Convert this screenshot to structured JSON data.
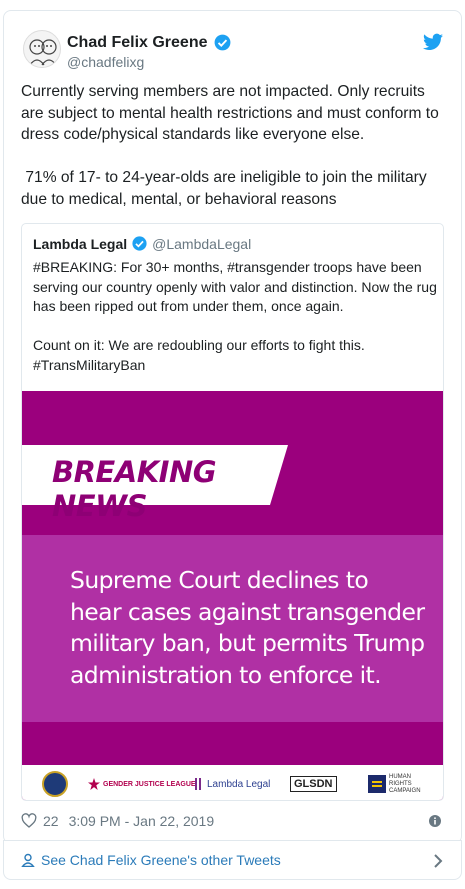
{
  "tweet": {
    "author_name": "Chad Felix Greene",
    "author_handle": "@chadfelixg",
    "text": "Currently serving members are not impacted. Only recruits are subject to mental health restrictions and must conform to dress code/physical standards like everyone else.\n\n 71% of 17- to 24-year-olds are ineligible to join the military due to medical, mental, or behavioral reasons",
    "likes": "22",
    "timestamp": "3:09 PM - Jan 22, 2019"
  },
  "quote": {
    "name": "Lambda Legal",
    "handle": "@LambdaLegal",
    "text": "#BREAKING: For 30+ months, #transgender troops have been serving our country openly with valor and distinction. Now the rug has been ripped out from under them, once again.\n\nCount on it: We are redoubling our efforts to fight this. #TransMilitaryBan",
    "media": {
      "ribbon": "BREAKING NEWS",
      "headline": "Supreme Court declines to\nhear cases against transgender\nmilitary ban, but permits Trump\nadministration to enforce it.",
      "logos": {
        "gender_justice": "GENDER JUSTICE LEAGUE",
        "lambda_legal": "Lambda Legal",
        "glad": "GLSDN",
        "hrc": "HUMAN RIGHTS CAMPAIGN"
      }
    }
  },
  "footer": {
    "other_tweets_label": "See Chad Felix Greene's other Tweets"
  },
  "icons": [
    "avatar-illustration",
    "verified-badge-icon",
    "twitter-bird-icon",
    "heart-icon",
    "info-icon",
    "person-icon",
    "chevron-right-icon"
  ],
  "colors": {
    "accent_blue": "#1da1f2",
    "link_blue": "#2b7bb9",
    "media_purple": "#9b007d",
    "media_band": "#b030a4"
  }
}
